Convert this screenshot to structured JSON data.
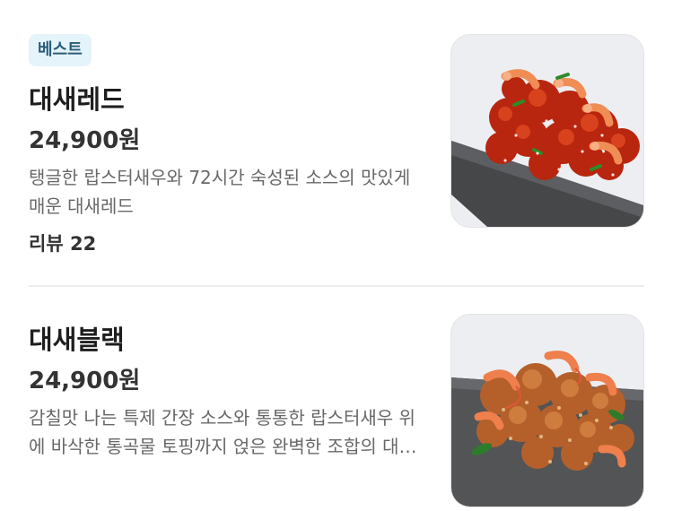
{
  "menu": {
    "items": [
      {
        "badge": "베스트",
        "name": "대새레드",
        "price": "24,900원",
        "description": "탱글한 랍스터새우와 72시간 숙성된 소스의 맛있게 매운 대새레드",
        "reviews": "리뷰 22",
        "image": "spicy-red-shrimp-chicken-on-slate"
      },
      {
        "name": "대새블랙",
        "price": "24,900원",
        "description": "감칠맛 나는 특제 간장 소스와 통통한 랍스터새우 위에 바삭한 통곡물 토핑까지 얹은 완벽한 조합의 대새블랙",
        "image": "crispy-soy-shrimp-chicken-on-slate"
      }
    ]
  },
  "colors": {
    "badge_bg": "#e5f3fa",
    "badge_text": "#2a5d78",
    "divider": "#ededed",
    "description_text": "#686868"
  }
}
